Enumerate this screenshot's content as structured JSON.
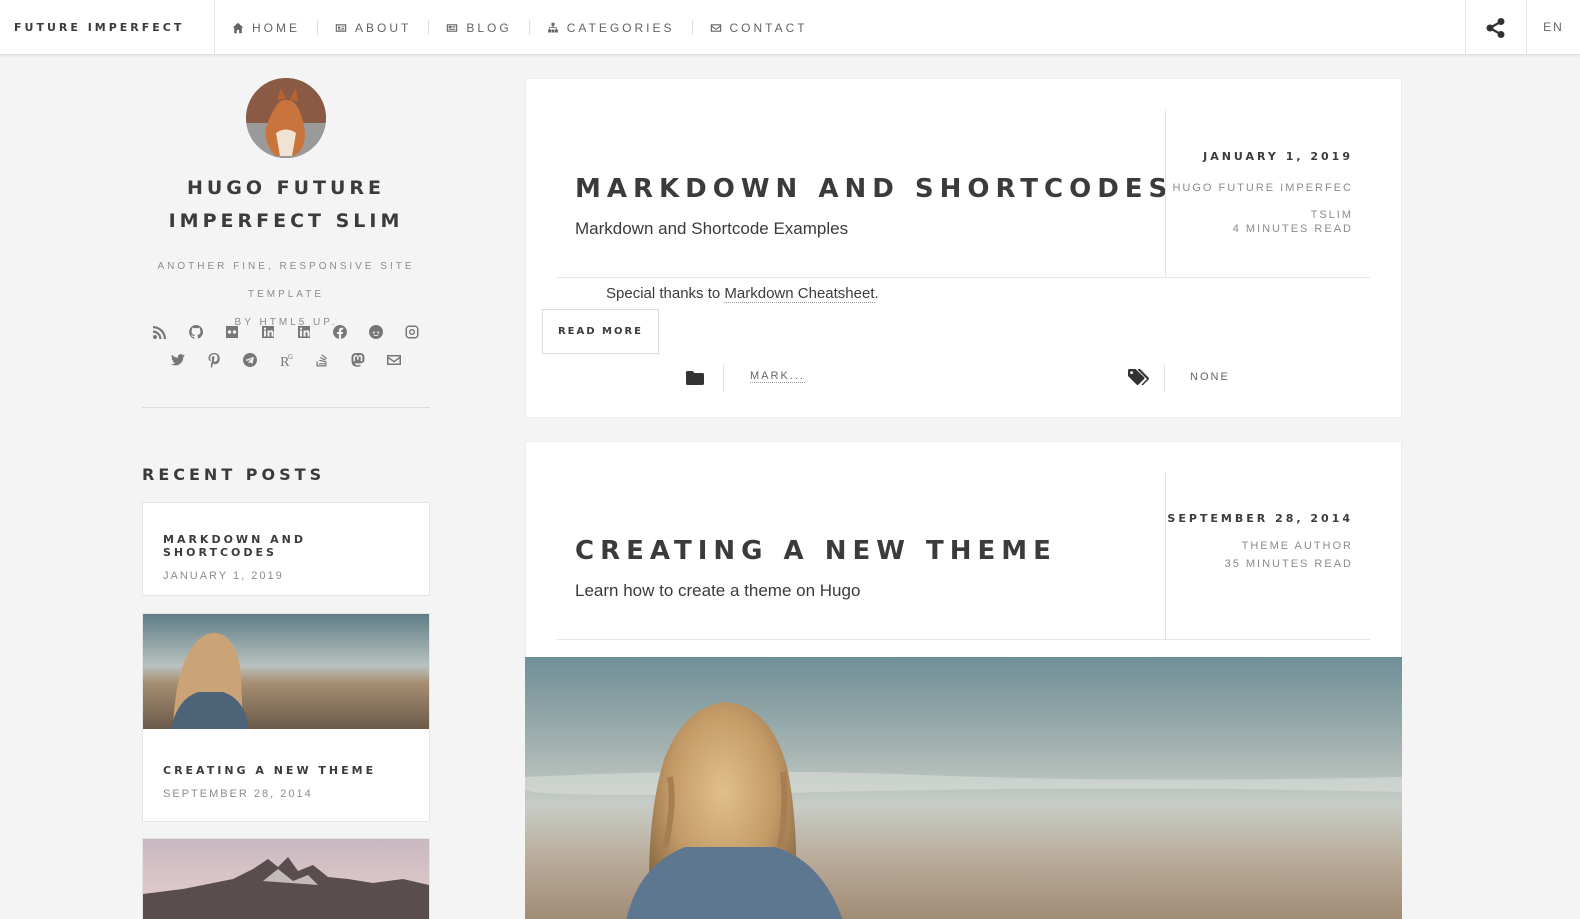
{
  "header": {
    "brand": "FUTURE IMPERFECT",
    "nav": [
      {
        "label": "HOME",
        "icon": "home-icon"
      },
      {
        "label": "ABOUT",
        "icon": "id-card-icon"
      },
      {
        "label": "BLOG",
        "icon": "newspaper-icon"
      },
      {
        "label": "CATEGORIES",
        "icon": "sitemap-icon"
      },
      {
        "label": "CONTACT",
        "icon": "envelope-icon"
      }
    ],
    "share_icon": "share-icon",
    "lang": "EN"
  },
  "sidebar": {
    "title": "HUGO FUTURE IMPERFECT SLIM",
    "title_line1": "HUGO FUTURE",
    "title_line2": "IMPERFECT SLIM",
    "desc_line1": "ANOTHER FINE, RESPONSIVE SITE TEMPLATE",
    "desc_line2": "BY HTML5 UP.",
    "social_icons": [
      "rss-icon",
      "github-icon",
      "flickr-icon",
      "linkedin-icon",
      "linkedin-square-icon",
      "facebook-icon",
      "reddit-icon",
      "instagram-icon",
      "twitter-icon",
      "pinterest-icon",
      "telegram-icon",
      "researchgate-icon",
      "stackoverflow-icon",
      "mastodon-icon",
      "email-icon"
    ],
    "recent_title": "RECENT POSTS",
    "recent": [
      {
        "title": "MARKDOWN AND SHORTCODES",
        "date": "JANUARY 1, 2019"
      },
      {
        "title": "CREATING A NEW THEME",
        "date": "SEPTEMBER 28, 2014"
      }
    ]
  },
  "posts": [
    {
      "title": "MARKDOWN AND SHORTCODES",
      "subtitle": "Markdown and Shortcode Examples",
      "date": "JANUARY 1, 2019",
      "author_line1": "HUGO FUTURE IMPERFEC",
      "author_line2": "TSLIM",
      "read_time": "4 MINUTES READ",
      "excerpt_prefix": "Special thanks to ",
      "excerpt_link": "Markdown Cheatsheet",
      "excerpt_suffix": ".",
      "read_more": "READ MORE",
      "category": "MARK...",
      "tags": "NONE"
    },
    {
      "title": "CREATING A NEW THEME",
      "subtitle": "Learn how to create a theme on Hugo",
      "date": "SEPTEMBER 28, 2014",
      "author": "THEME AUTHOR",
      "read_time": "35 MINUTES READ"
    }
  ]
}
